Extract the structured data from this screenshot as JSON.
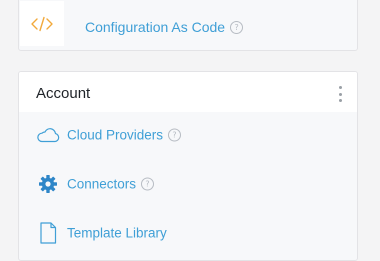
{
  "top_card": {
    "label": "Configuration As Code",
    "icon": "code-icon",
    "help": "?"
  },
  "account": {
    "title": "Account",
    "menu_icon": "more-vertical-icon",
    "items": [
      {
        "label": "Cloud Providers",
        "icon": "cloud-icon",
        "help": "?"
      },
      {
        "label": "Connectors",
        "icon": "gear-icon",
        "help": "?"
      },
      {
        "label": "Template Library",
        "icon": "document-icon"
      }
    ]
  },
  "colors": {
    "link": "#3f9fd6",
    "icon_orange": "#f2a93b",
    "icon_blue": "#2e86c8"
  }
}
